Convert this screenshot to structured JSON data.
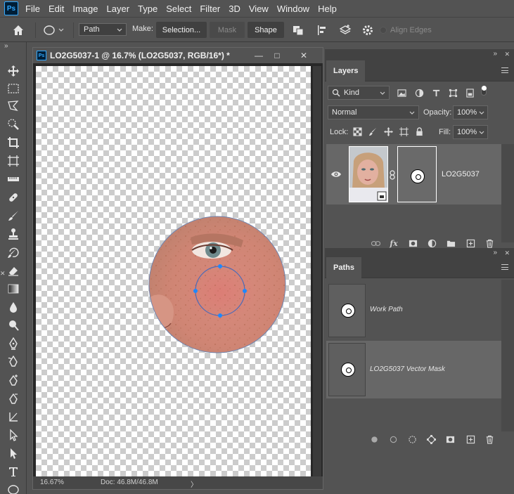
{
  "app": {
    "logo": "Ps"
  },
  "menu": [
    "File",
    "Edit",
    "Image",
    "Layer",
    "Type",
    "Select",
    "Filter",
    "3D",
    "View",
    "Window",
    "Help"
  ],
  "options": {
    "mode": "Path",
    "make_label": "Make:",
    "selection_btn": "Selection...",
    "mask_btn": "Mask",
    "shape_btn": "Shape",
    "align_edges": "Align Edges"
  },
  "document": {
    "tab_title": "LO2G5037-1 @ 16.7% (LO2G5037, RGB/16*) *",
    "zoom": "16.67%",
    "doc_size": "Doc: 46.8M/46.8M",
    "status_arrow": "〉"
  },
  "layers_panel": {
    "tab": "Layers",
    "filter_kind": "Kind",
    "blend_mode": "Normal",
    "opacity_label": "Opacity:",
    "opacity_value": "100%",
    "lock_label": "Lock:",
    "fill_label": "Fill:",
    "fill_value": "100%",
    "layer_name": "LO2G5037",
    "fx_label": "fx"
  },
  "paths_panel": {
    "tab": "Paths",
    "paths": [
      "Work Path",
      "LO2G5037 Vector Mask"
    ]
  },
  "icons": {
    "close_x": "✕",
    "minimize": "—",
    "maximize": "□",
    "collapse": "»",
    "panel_collapse": "»",
    "panel_close": "✕"
  },
  "colors": {
    "app_bg": "#535353",
    "canvas_dark": "#282828",
    "accent_blue": "#31a8ff",
    "path_point": "#1e88ff",
    "panel_header": "#424242",
    "selected_row": "#676767"
  }
}
